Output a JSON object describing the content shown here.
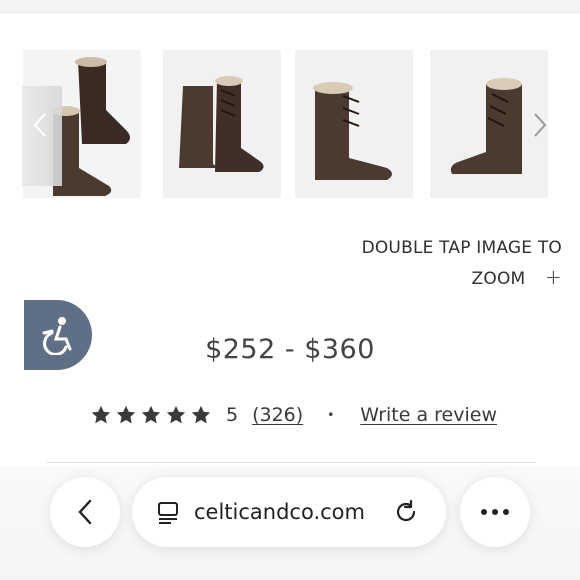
{
  "carousel": {
    "thumbnails": [
      {
        "alt": "boot pair view"
      },
      {
        "alt": "boot side view"
      },
      {
        "alt": "boot front view"
      },
      {
        "alt": "boot back view"
      }
    ],
    "prev_icon": "chevron-left-icon",
    "next_icon": "chevron-right-icon"
  },
  "zoom_hint": {
    "line1": "DOUBLE TAP IMAGE TO",
    "line2": "ZOOM",
    "plus": "+"
  },
  "accessibility": {
    "icon": "wheelchair-icon"
  },
  "product": {
    "price": "$252 - $360",
    "rating": {
      "stars": 5,
      "value": "5",
      "count": "(326)",
      "separator": "•",
      "write_review": "Write a review"
    }
  },
  "browser": {
    "url": "celticandco.com",
    "back_icon": "chevron-left-icon",
    "page_icon": "page-menu-icon",
    "reload_icon": "reload-icon",
    "more_icon": "more-icon"
  },
  "colors": {
    "accent": "#5f6f86",
    "text": "#3c3c3c",
    "boot": "#4a3a30"
  }
}
